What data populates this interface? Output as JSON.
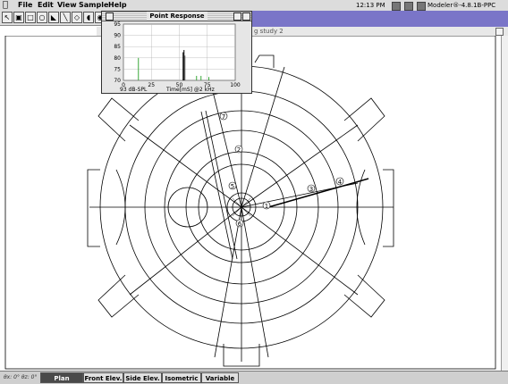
{
  "menubar": {
    "menus": [
      "File",
      "Edit",
      "View",
      "Sample",
      "Help"
    ],
    "clock": "12:13 PM",
    "app_name": "Modeler®-4.8.1B-PPC"
  },
  "window": {
    "title_fragment": "g study 2"
  },
  "point_response": {
    "title": "Point Response",
    "footer_left": "93 dB-SPL",
    "footer_right": "Time[mS] @2 kHz"
  },
  "chart_data": {
    "type": "bar",
    "title": "Point Response",
    "xlabel": "Time[mS] @2 kHz",
    "ylabel": "",
    "xlim": [
      0,
      100
    ],
    "ylim": [
      70,
      95
    ],
    "xticks": [
      "0",
      "25",
      "50",
      "75",
      "100"
    ],
    "yticks": [
      "95",
      "90",
      "85",
      "80",
      "75",
      "70"
    ],
    "grid": true,
    "bars": [
      {
        "x": 13,
        "y": 80,
        "color": "#3aa83a"
      },
      {
        "x": 53,
        "y": 82.5,
        "color": "#000000"
      },
      {
        "x": 53.8,
        "y": 83.5,
        "color": "#000000"
      },
      {
        "x": 54.6,
        "y": 81,
        "color": "#555555"
      },
      {
        "x": 65,
        "y": 72,
        "color": "#3aa83a"
      },
      {
        "x": 69,
        "y": 72,
        "color": "#3aa83a"
      },
      {
        "x": 76,
        "y": 71.5,
        "color": "#3aa83a"
      }
    ]
  },
  "plan": {
    "markers": [
      "1",
      "2",
      "3",
      "4",
      "5",
      "6",
      "7"
    ]
  },
  "statusbar": {
    "coords": "θx: 0°  θz: 0°",
    "tabs": [
      "Plan",
      "Front Elev.",
      "Side Elev.",
      "Isometric",
      "Variable"
    ],
    "active_tab": "Plan"
  },
  "colors": {
    "titlebar_accent": "#7a75c8",
    "chart_green": "#3aa83a"
  }
}
